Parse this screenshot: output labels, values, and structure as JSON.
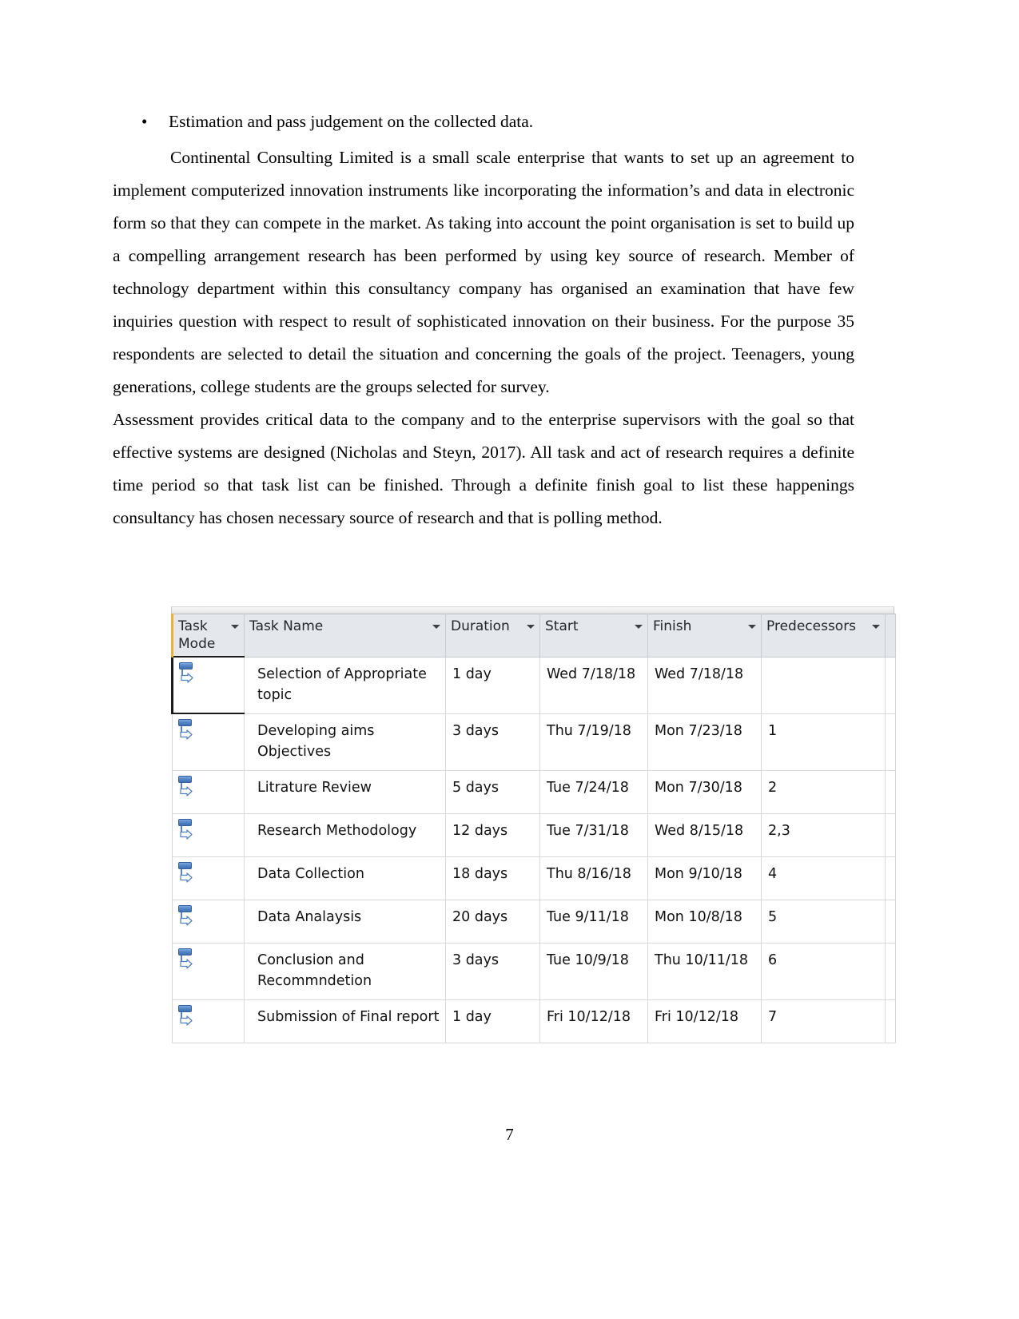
{
  "document": {
    "page_number": "7",
    "bullet": {
      "marker": "•",
      "text": "Estimation and pass judgement on the collected data."
    },
    "paragraphs": [
      "Continental Consulting Limited is a small scale enterprise that wants to set up an agreement to implement computerized innovation instruments like incorporating the information’s and data in electronic form so that they can compete in the market.  As taking into account the point organisation is set to build up a compelling arrangement research has been performed by using key source of research. Member of technology department within this consultancy company has organised an examination that have few inquiries question with respect to result of sophisticated innovation on their business. For the purpose 35 respondents are selected to detail the situation and concerning the goals of the project. Teenagers, young generations, college students are the groups selected for survey.",
      "Assessment provides critical data to the company and to the enterprise supervisors with the goal so that effective systems are designed (Nicholas and Steyn, 2017). All task and act of research requires a definite time period so that task list can be finished. Through a definite finish goal to list these happenings consultancy has chosen necessary source of research and that is polling method."
    ]
  },
  "project_table": {
    "columns": [
      {
        "key": "mode",
        "label": "Task\nMode",
        "has_filter": true
      },
      {
        "key": "name",
        "label": "Task Name",
        "has_filter": true
      },
      {
        "key": "dur",
        "label": "Duration",
        "has_filter": true
      },
      {
        "key": "start",
        "label": "Start",
        "has_filter": true
      },
      {
        "key": "fin",
        "label": "Finish",
        "has_filter": true
      },
      {
        "key": "pred",
        "label": "Predecessors",
        "has_filter": true
      }
    ],
    "mode_icon_name": "auto-scheduled-icon",
    "rows": [
      {
        "mode_icon": "auto-scheduled-icon",
        "name": "Selection of Appropriate topic",
        "duration": "1 day",
        "start": "Wed 7/18/18",
        "finish": "Wed 7/18/18",
        "predecessors": "",
        "selected": true
      },
      {
        "mode_icon": "auto-scheduled-icon",
        "name": "Developing aims Objectives",
        "duration": "3 days",
        "start": "Thu 7/19/18",
        "finish": "Mon 7/23/18",
        "predecessors": "1",
        "selected": false
      },
      {
        "mode_icon": "auto-scheduled-icon",
        "name": "Litrature Review",
        "duration": "5 days",
        "start": "Tue 7/24/18",
        "finish": "Mon 7/30/18",
        "predecessors": "2",
        "selected": false
      },
      {
        "mode_icon": "auto-scheduled-icon",
        "name": "Research Methodology",
        "duration": "12 days",
        "start": "Tue 7/31/18",
        "finish": "Wed 8/15/18",
        "predecessors": "2,3",
        "selected": false
      },
      {
        "mode_icon": "auto-scheduled-icon",
        "name": "Data Collection",
        "duration": "18 days",
        "start": "Thu 8/16/18",
        "finish": "Mon 9/10/18",
        "predecessors": "4",
        "selected": false
      },
      {
        "mode_icon": "auto-scheduled-icon",
        "name": "Data Analaysis",
        "duration": "20 days",
        "start": "Tue 9/11/18",
        "finish": "Mon 10/8/18",
        "predecessors": "5",
        "selected": false
      },
      {
        "mode_icon": "auto-scheduled-icon",
        "name": "Conclusion and Recommndetion",
        "duration": "3 days",
        "start": "Tue 10/9/18",
        "finish": "Thu 10/11/18",
        "predecessors": "6",
        "selected": false
      },
      {
        "mode_icon": "auto-scheduled-icon",
        "name": "Submission of Final report",
        "duration": "1 day",
        "start": "Fri 10/12/18",
        "finish": "Fri 10/12/18",
        "predecessors": "7",
        "selected": false
      }
    ]
  },
  "colors": {
    "header_bg": "#e4e7ec",
    "header_accent": "#e8b23a",
    "grid_line": "#d6d8dc",
    "icon_blue": "#4f82c4"
  }
}
